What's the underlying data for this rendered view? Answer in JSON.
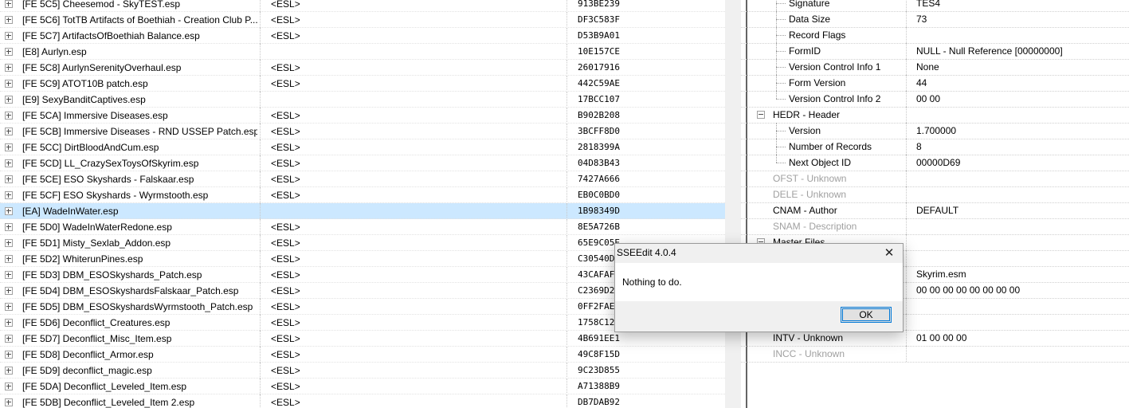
{
  "plugins": [
    {
      "name": "[FE 5C5] Cheesemod - SkyTEST.esp",
      "flag": "<ESL>",
      "crc": "913BE239"
    },
    {
      "name": "[FE 5C6] TotTB Artifacts of Boethiah - Creation Club P...",
      "flag": "<ESL>",
      "crc": "DF3C583F"
    },
    {
      "name": "[FE 5C7] ArtifactsOfBoethiah Balance.esp",
      "flag": "<ESL>",
      "crc": "D53B9A01"
    },
    {
      "name": "[E8] Aurlyn.esp",
      "flag": "",
      "crc": "10E157CE"
    },
    {
      "name": "[FE 5C8] AurlynSerenityOverhaul.esp",
      "flag": "<ESL>",
      "crc": "26017916"
    },
    {
      "name": "[FE 5C9] ATOT10B patch.esp",
      "flag": "<ESL>",
      "crc": "442C59AE"
    },
    {
      "name": "[E9] SexyBanditCaptives.esp",
      "flag": "",
      "crc": "17BCC107"
    },
    {
      "name": "[FE 5CA] Immersive Diseases.esp",
      "flag": "<ESL>",
      "crc": "B902B208"
    },
    {
      "name": "[FE 5CB] Immersive Diseases - RND USSEP Patch.esp",
      "flag": "<ESL>",
      "crc": "3BCFF8D0"
    },
    {
      "name": "[FE 5CC] DirtBloodAndCum.esp",
      "flag": "<ESL>",
      "crc": "2818399A"
    },
    {
      "name": "[FE 5CD] LL_CrazySexToysOfSkyrim.esp",
      "flag": "<ESL>",
      "crc": "04D83B43"
    },
    {
      "name": "[FE 5CE] ESO Skyshards - Falskaar.esp",
      "flag": "<ESL>",
      "crc": "7427A666"
    },
    {
      "name": "[FE 5CF] ESO Skyshards - Wyrmstooth.esp",
      "flag": "<ESL>",
      "crc": "EB0C0BD0"
    },
    {
      "name": "[EA] WadeInWater.esp",
      "flag": "",
      "crc": "1B98349D",
      "selected": true
    },
    {
      "name": "[FE 5D0] WadeInWaterRedone.esp",
      "flag": "<ESL>",
      "crc": "8E5A726B"
    },
    {
      "name": "[FE 5D1] Misty_Sexlab_Addon.esp",
      "flag": "<ESL>",
      "crc": "65E9C05E"
    },
    {
      "name": "[FE 5D2] WhiterunPines.esp",
      "flag": "<ESL>",
      "crc": "C30540D"
    },
    {
      "name": "[FE 5D3] DBM_ESOSkyshards_Patch.esp",
      "flag": "<ESL>",
      "crc": "43CAFAF"
    },
    {
      "name": "[FE 5D4] DBM_ESOSkyshardsFalskaar_Patch.esp",
      "flag": "<ESL>",
      "crc": "C2369D2"
    },
    {
      "name": "[FE 5D5] DBM_ESOSkyshardsWyrmstooth_Patch.esp",
      "flag": "<ESL>",
      "crc": "0FF2FAE"
    },
    {
      "name": "[FE 5D6] Deconflict_Creatures.esp",
      "flag": "<ESL>",
      "crc": "1758C12"
    },
    {
      "name": "[FE 5D7] Deconflict_Misc_Item.esp",
      "flag": "<ESL>",
      "crc": "4B691EE1"
    },
    {
      "name": "[FE 5D8] Deconflict_Armor.esp",
      "flag": "<ESL>",
      "crc": "49C8F15D"
    },
    {
      "name": "[FE 5D9] deconflict_magic.esp",
      "flag": "<ESL>",
      "crc": "9C23D855"
    },
    {
      "name": "[FE 5DA] Deconflict_Leveled_Item.esp",
      "flag": "<ESL>",
      "crc": "A71388B9"
    },
    {
      "name": "[FE 5DB] Deconflict_Leveled_Item 2.esp",
      "flag": "<ESL>",
      "crc": "DB7DAB92"
    }
  ],
  "record_fields": [
    {
      "label": "Signature",
      "value": "TES4",
      "level": 2,
      "grey": false,
      "expander": false
    },
    {
      "label": "Data Size",
      "value": "73",
      "level": 2,
      "grey": false,
      "expander": false
    },
    {
      "label": "Record Flags",
      "value": "",
      "level": 2,
      "grey": false,
      "expander": false
    },
    {
      "label": "FormID",
      "value": "NULL - Null Reference [00000000]",
      "level": 2,
      "grey": false,
      "expander": false
    },
    {
      "label": "Version Control Info 1",
      "value": "None",
      "level": 2,
      "grey": false,
      "expander": false
    },
    {
      "label": "Form Version",
      "value": "44",
      "level": 2,
      "grey": false,
      "expander": false
    },
    {
      "label": "Version Control Info 2",
      "value": "00 00",
      "level": 2,
      "grey": false,
      "expander": false,
      "last": true
    },
    {
      "label": "HEDR - Header",
      "value": "",
      "level": 1,
      "grey": false,
      "expander": true
    },
    {
      "label": "Version",
      "value": "1.700000",
      "level": 2,
      "grey": false,
      "expander": false
    },
    {
      "label": "Number of Records",
      "value": "8",
      "level": 2,
      "grey": false,
      "expander": false
    },
    {
      "label": "Next Object ID",
      "value": "00000D69",
      "level": 2,
      "grey": false,
      "expander": false,
      "last": true
    },
    {
      "label": "OFST - Unknown",
      "value": "",
      "level": 1,
      "grey": true,
      "expander": false
    },
    {
      "label": "DELE - Unknown",
      "value": "",
      "level": 1,
      "grey": true,
      "expander": false
    },
    {
      "label": "CNAM - Author",
      "value": "DEFAULT",
      "level": 1,
      "grey": false,
      "expander": false
    },
    {
      "label": "SNAM - Description",
      "value": "",
      "level": 1,
      "grey": true,
      "expander": false
    },
    {
      "label": "Master Files",
      "value": "",
      "level": 1,
      "grey": false,
      "expander": true
    },
    {
      "label": "",
      "value": "",
      "level": 2,
      "grey": false,
      "expander": false
    },
    {
      "label": "",
      "value": "Skyrim.esm",
      "level": 2,
      "grey": false,
      "expander": false
    },
    {
      "label": "",
      "value": "00 00 00 00 00 00 00 00",
      "level": 2,
      "grey": false,
      "expander": false
    },
    {
      "label": "",
      "value": "",
      "level": 1,
      "grey": false,
      "expander": false
    },
    {
      "label": "",
      "value": "",
      "level": 1,
      "grey": false,
      "expander": false
    },
    {
      "label": "INTV - Unknown",
      "value": "01 00 00 00",
      "level": 1,
      "grey": false,
      "expander": false
    },
    {
      "label": "INCC - Unknown",
      "value": "",
      "level": 1,
      "grey": true,
      "expander": false
    }
  ],
  "dialog": {
    "title": "SSEEdit 4.0.4",
    "close_glyph": "✕",
    "message": "Nothing to do.",
    "ok_label": "OK"
  }
}
